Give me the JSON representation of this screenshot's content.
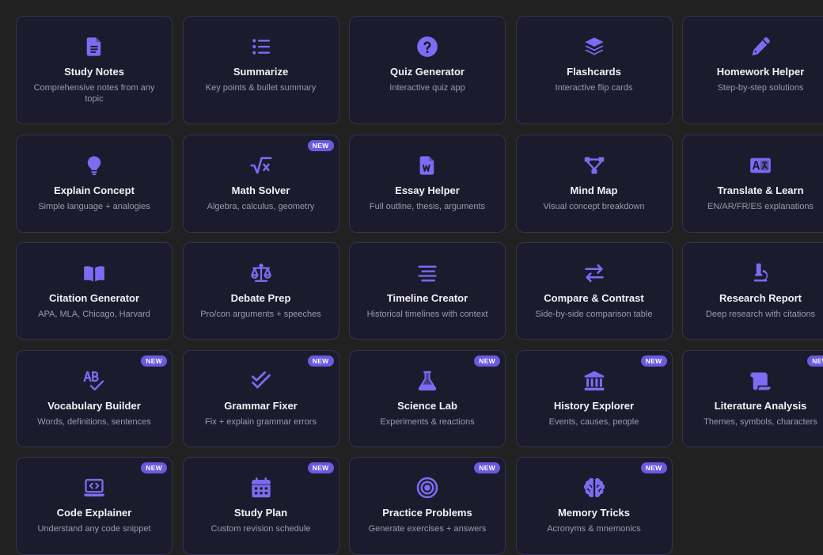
{
  "accent_color": "#7c6cf2",
  "badge_color": "#6a5ae0",
  "badge_label": "NEW",
  "tools": [
    {
      "title": "Study Notes",
      "desc": "Comprehensive notes from any topic",
      "icon": "document-icon",
      "new": false
    },
    {
      "title": "Summarize",
      "desc": "Key points & bullet summary",
      "icon": "list-icon",
      "new": false
    },
    {
      "title": "Quiz Generator",
      "desc": "Interactive quiz app",
      "icon": "question-circle-icon",
      "new": false
    },
    {
      "title": "Flashcards",
      "desc": "Interactive flip cards",
      "icon": "layers-icon",
      "new": false
    },
    {
      "title": "Homework Helper",
      "desc": "Step-by-step solutions",
      "icon": "pencil-icon",
      "new": false
    },
    {
      "title": "Explain Concept",
      "desc": "Simple language + analogies",
      "icon": "lightbulb-icon",
      "new": false
    },
    {
      "title": "Math Solver",
      "desc": "Algebra, calculus, geometry",
      "icon": "square-root-icon",
      "new": true
    },
    {
      "title": "Essay Helper",
      "desc": "Full outline, thesis, arguments",
      "icon": "word-document-icon",
      "new": false
    },
    {
      "title": "Mind Map",
      "desc": "Visual concept breakdown",
      "icon": "diagram-icon",
      "new": false
    },
    {
      "title": "Translate & Learn",
      "desc": "EN/AR/FR/ES explanations",
      "icon": "language-icon",
      "new": false
    },
    {
      "title": "Citation Generator",
      "desc": "APA, MLA, Chicago, Harvard",
      "icon": "open-book-icon",
      "new": false
    },
    {
      "title": "Debate Prep",
      "desc": "Pro/con arguments + speeches",
      "icon": "scale-icon",
      "new": false
    },
    {
      "title": "Timeline Creator",
      "desc": "Historical timelines with context",
      "icon": "align-center-icon",
      "new": false
    },
    {
      "title": "Compare & Contrast",
      "desc": "Side-by-side comparison table",
      "icon": "swap-arrows-icon",
      "new": false
    },
    {
      "title": "Research Report",
      "desc": "Deep research with citations",
      "icon": "microscope-icon",
      "new": false
    },
    {
      "title": "Vocabulary Builder",
      "desc": "Words, definitions, sentences",
      "icon": "spell-check-icon",
      "new": true
    },
    {
      "title": "Grammar Fixer",
      "desc": "Fix + explain grammar errors",
      "icon": "double-check-icon",
      "new": true
    },
    {
      "title": "Science Lab",
      "desc": "Experiments & reactions",
      "icon": "flask-icon",
      "new": true
    },
    {
      "title": "History Explorer",
      "desc": "Events, causes, people",
      "icon": "landmark-icon",
      "new": true
    },
    {
      "title": "Literature Analysis",
      "desc": "Themes, symbols, characters",
      "icon": "scroll-icon",
      "new": true
    },
    {
      "title": "Code Explainer",
      "desc": "Understand any code snippet",
      "icon": "laptop-code-icon",
      "new": true
    },
    {
      "title": "Study Plan",
      "desc": "Custom revision schedule",
      "icon": "calendar-icon",
      "new": true
    },
    {
      "title": "Practice Problems",
      "desc": "Generate exercises + answers",
      "icon": "target-icon",
      "new": true
    },
    {
      "title": "Memory Tricks",
      "desc": "Acronyms & mnemonics",
      "icon": "brain-icon",
      "new": true
    }
  ]
}
